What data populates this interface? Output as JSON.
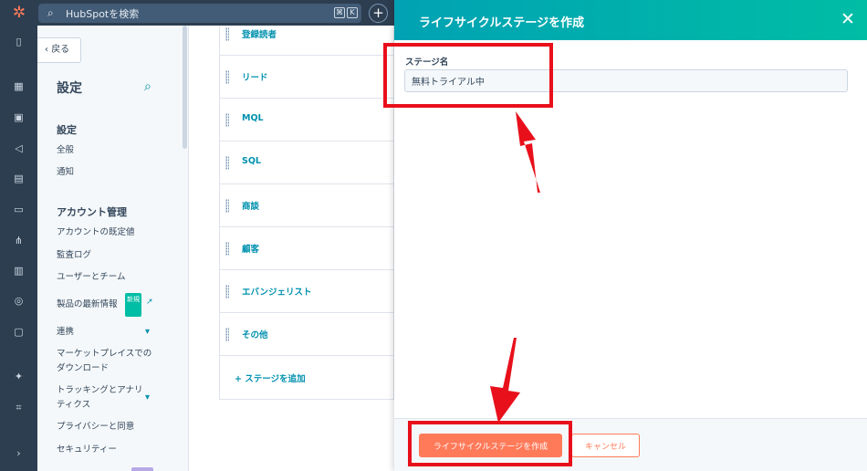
{
  "topbar": {
    "search_placeholder": "HubSpotを検索",
    "shortcut_keys": [
      "⌘",
      "K"
    ],
    "colors": {
      "bar": "#2d3e50",
      "logo": "#ff7a59"
    }
  },
  "rail": {
    "icons": [
      "bookmark-icon",
      "grid-icon",
      "contacts-icon",
      "megaphone-icon",
      "document-icon",
      "deal-icon",
      "network-icon",
      "chart-icon",
      "database-icon",
      "folder-icon",
      "sparkle-icon",
      "code-icon",
      "expand-icon"
    ]
  },
  "sidebar": {
    "back_label": "戻る",
    "title": "設定",
    "sections": [
      {
        "heading": "設定",
        "items": [
          "全般",
          "通知"
        ]
      },
      {
        "heading": "アカウント管理",
        "items": [
          "アカウントの既定値",
          "監査ログ",
          "ユーザーとチーム",
          "製品の最新情報",
          "連携",
          "マーケットプレイスでの\nダウンロード",
          "トラッキングとアナリ\nティクス",
          "プライバシーと同意",
          "セキュリティー"
        ]
      }
    ],
    "new_badge": "新規"
  },
  "stages": {
    "items": [
      "登録読者",
      "リード",
      "MQL",
      "SQL",
      "商談",
      "顧客",
      "エバンジェリスト",
      "その他"
    ],
    "add_label": "ステージを追加"
  },
  "panel": {
    "title": "ライフサイクルステージを作成",
    "field_label": "ステージ名",
    "field_value": "無料トライアル中",
    "create_button": "ライフサイクルステージを作成",
    "cancel_button": "キャンセル",
    "colors": {
      "header_start": "#00a2b3",
      "header_end": "#00bda5",
      "primary": "#ff7a59"
    }
  },
  "annotations": {
    "highlight_color": "#e8101b"
  }
}
